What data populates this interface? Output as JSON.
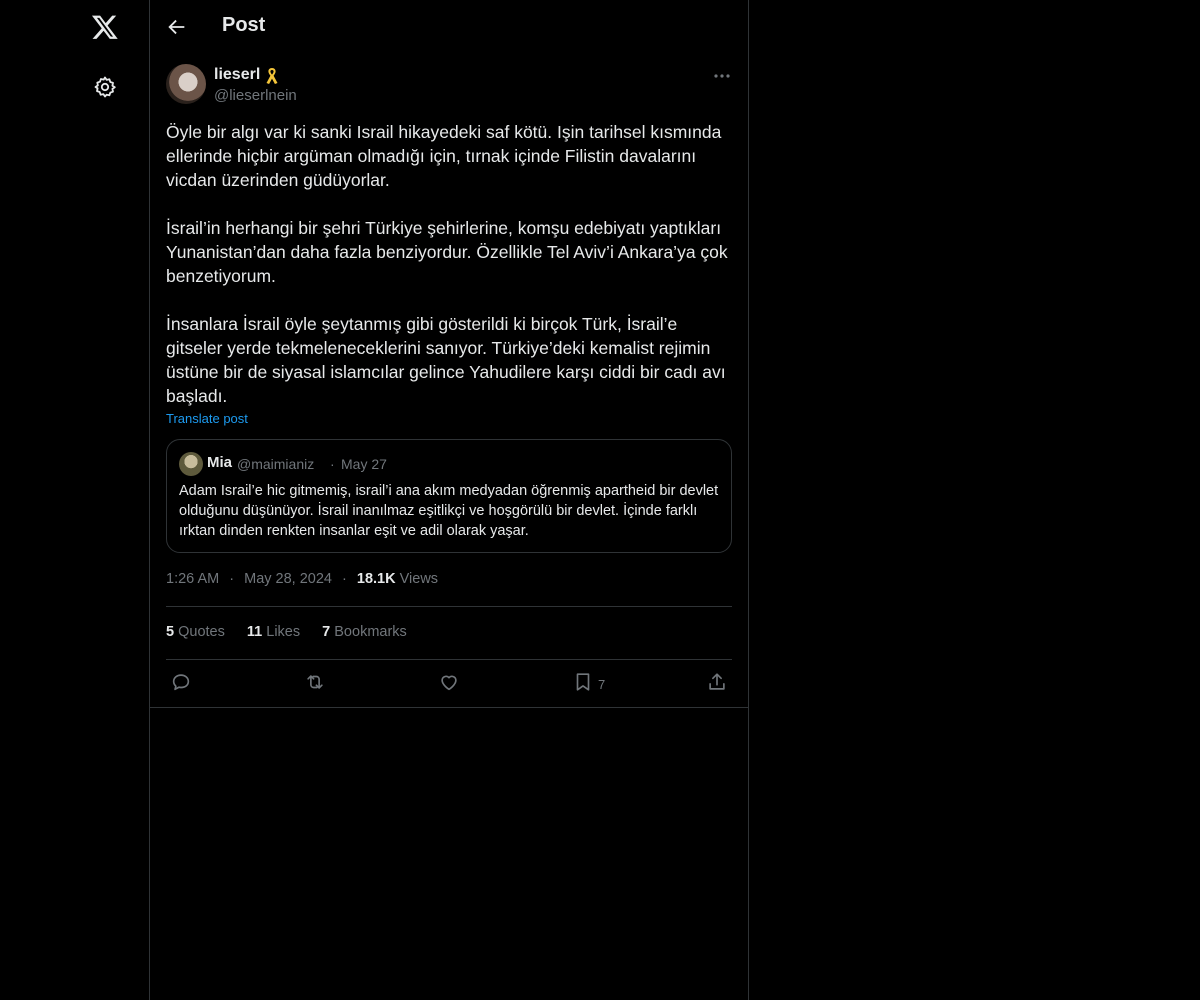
{
  "nav": {
    "logo_icon": "x-logo-icon",
    "settings_icon": "gear-icon"
  },
  "header": {
    "title": "Post",
    "back_icon": "arrow-left-icon"
  },
  "post": {
    "author_name": "lieserl",
    "author_badge_icon": "yellow-ribbon-icon",
    "author_handle": "@lieserlnein",
    "text": "Öyle bir algı var ki sanki Israil hikayedeki saf kötü. Işin tarihsel kısmında ellerinde hiçbir argüman olmadığı için, tırnak içinde Filistin davalarını vicdan üzerinden güdüyorlar.\n\nİsrail’in herhangi bir şehri Türkiye şehirlerine, komşu edebiyatı yaptıkları Yunanistan’dan daha fazla benziyordur. Özellikle Tel Aviv’i Ankara’ya çok benzetiyorum.\n\nİnsanlara İsrail öyle şeytanmış gibi gösterildi ki birçok Türk, İsrail’e gitseler yerde tekmeleneceklerini sanıyor. Türkiye’deki kemalist rejimin üstüne bir de siyasal islamcılar gelince Yahudilere karşı ciddi bir cadı avı başladı.",
    "translate_label": "Translate post",
    "quote": {
      "name": "Mia",
      "handle": "@maimianiz",
      "separator": "·",
      "date": "May 27",
      "text": "Adam Israil’e hic gitmemiş, israil’i ana akım medyadan öğrenmiş apartheid bir devlet olduğunu düşünüyor. İsrail inanılmaz eşitlikçi ve hoşgörülü bir devlet. İçinde farklı ırktan dinden renkten insanlar eşit ve adil olarak yaşar."
    },
    "time": "1:26 AM",
    "separator": "·",
    "date": "May 28, 2024",
    "views_count": "18.1K",
    "views_label": "Views",
    "stats": {
      "quotes_count": "5",
      "quotes_label": "Quotes",
      "likes_count": "11",
      "likes_label": "Likes",
      "bookmarks_count": "7",
      "bookmarks_label": "Bookmarks"
    },
    "actions": {
      "reply_icon": "reply-icon",
      "repost_icon": "repost-icon",
      "like_icon": "heart-icon",
      "bookmark_icon": "bookmark-icon",
      "bookmark_count": "7",
      "share_icon": "share-icon"
    }
  },
  "colors": {
    "background": "#000000",
    "text": "#e7e9ea",
    "muted": "#71767b",
    "link": "#1d9bf0",
    "border": "#2f3336"
  }
}
